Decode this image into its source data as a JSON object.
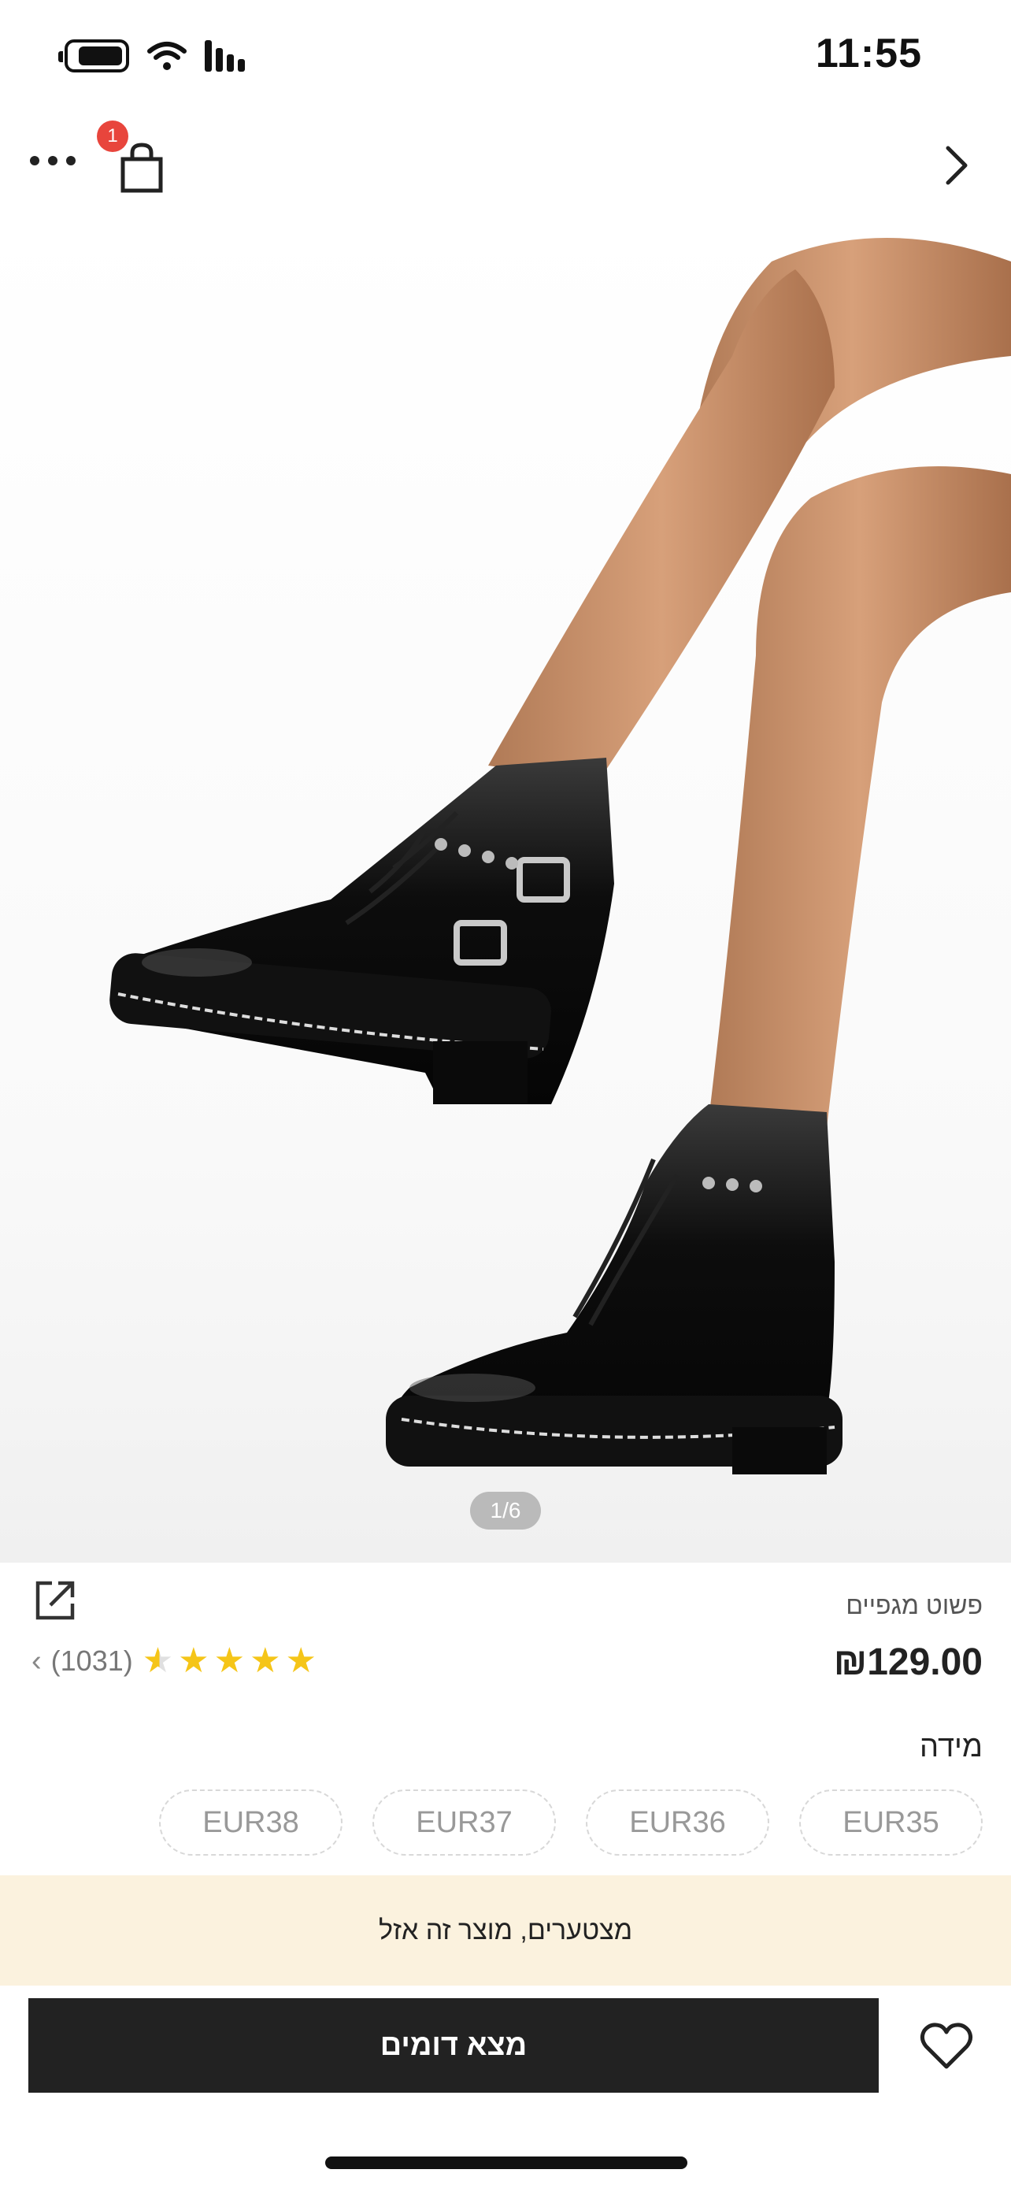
{
  "status_bar": {
    "time": "11:55",
    "battery_level": 0.7,
    "icons": [
      "battery-icon",
      "wifi-icon",
      "cellular-signal-icon"
    ]
  },
  "nav": {
    "cart_badge": "1",
    "icons": [
      "more-icon",
      "shopping-bag-icon",
      "chevron-right-icon"
    ]
  },
  "gallery": {
    "indicator": "1/6",
    "image_description": "black patent leather lace-up buckle combat boots"
  },
  "product": {
    "title": "פשוט מגפיים",
    "price": "₪129.00",
    "rating": {
      "stars": 4.5,
      "count": "(1031)"
    }
  },
  "sizes": {
    "label": "מידה",
    "options": [
      "EUR35",
      "EUR36",
      "EUR37",
      "EUR38"
    ]
  },
  "notice": {
    "text": "מצטערים, מוצר זה אזל"
  },
  "actions": {
    "primary_label": "מצא דומים"
  },
  "colors": {
    "accent": "#222222",
    "badge": "#e8453c",
    "star": "#f5c518",
    "banner": "#fbf2de"
  }
}
